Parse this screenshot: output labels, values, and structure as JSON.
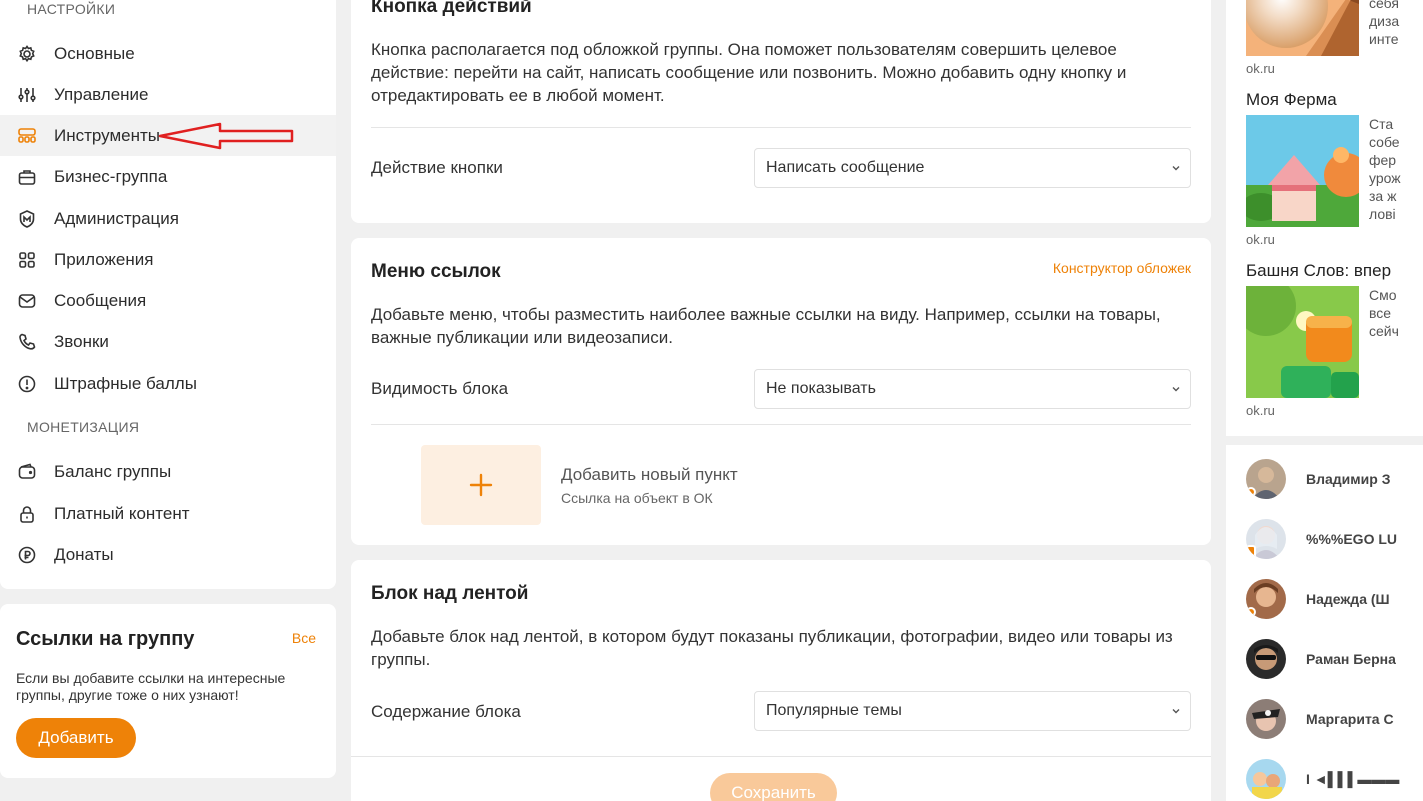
{
  "sidebar": {
    "settings_title": "НАСТРОЙКИ",
    "items": [
      {
        "label": "Основные",
        "icon": "gear-icon"
      },
      {
        "label": "Управление",
        "icon": "sliders-icon"
      },
      {
        "label": "Инструменты",
        "icon": "tools-icon"
      },
      {
        "label": "Бизнес-группа",
        "icon": "briefcase-icon"
      },
      {
        "label": "Администрация",
        "icon": "shield-icon"
      },
      {
        "label": "Приложения",
        "icon": "apps-grid-icon"
      },
      {
        "label": "Сообщения",
        "icon": "envelope-icon"
      },
      {
        "label": "Звонки",
        "icon": "phone-icon"
      },
      {
        "label": "Штрафные баллы",
        "icon": "warning-circle-icon"
      }
    ],
    "monetization_title": "МОНЕТИЗАЦИЯ",
    "monetization_items": [
      {
        "label": "Баланс группы",
        "icon": "wallet-icon"
      },
      {
        "label": "Платный контент",
        "icon": "lock-icon"
      },
      {
        "label": "Донаты",
        "icon": "ruble-coin-icon"
      }
    ],
    "active_item": "Инструменты"
  },
  "links_card": {
    "title": "Ссылки на группу",
    "all_link": "Все",
    "text": "Если вы добавите ссылки на интересные группы, другие тоже о них узнают!",
    "add_button": "Добавить"
  },
  "action_button_card": {
    "title": "Кнопка действий",
    "description": "Кнопка располагается под обложкой группы. Она поможет пользователям совершить целевое действие: перейти на сайт, написать сообщение или позвонить. Можно добавить одну кнопку и отредактировать ее в любой момент.",
    "field_label": "Действие кнопки",
    "field_value": "Написать сообщение"
  },
  "links_menu_card": {
    "title": "Меню ссылок",
    "cover_builder_link": "Конструктор обложек",
    "description": "Добавьте меню, чтобы разместить наиболее важные ссылки на виду. Например, ссылки на товары, важные публикации или видеозаписи.",
    "field_label": "Видимость блока",
    "field_value": "Не показывать",
    "add_item_title": "Добавить новый пункт",
    "add_item_subtitle": "Ссылка на объект в ОК"
  },
  "feed_block_card": {
    "title": "Блок над лентой",
    "description": "Добавьте блок над лентой, в котором будут показаны публикации, фотографии, видео или товары из группы.",
    "field_label": "Содержание блока",
    "field_value": "Популярные темы",
    "save_button": "Сохранить"
  },
  "games": [
    {
      "title": "",
      "source": "ok.ru",
      "desc": [
        "себя",
        "диза",
        "инте"
      ]
    },
    {
      "title": "Моя Ферма",
      "source": "ok.ru",
      "desc": [
        "Ста",
        "собе",
        "фер",
        "урож",
        "за ж",
        "лові"
      ]
    },
    {
      "title": "Башня Слов: впер",
      "source": "ok.ru",
      "desc": [
        "Смо",
        "все",
        "сейч"
      ]
    }
  ],
  "friends": [
    {
      "name": "Владимир З",
      "status": "online"
    },
    {
      "name": "%%%EGO LU",
      "status": "mobile"
    },
    {
      "name": "Надежда (Ш",
      "status": "online"
    },
    {
      "name": "Раман Берна",
      "status": "none"
    },
    {
      "name": "Маргарита С",
      "status": "none"
    },
    {
      "name": "I ◄▌▌▌▬▬▬",
      "status": "none"
    }
  ],
  "colors": {
    "accent": "#ee8208",
    "annotation_arrow": "#e02020"
  }
}
